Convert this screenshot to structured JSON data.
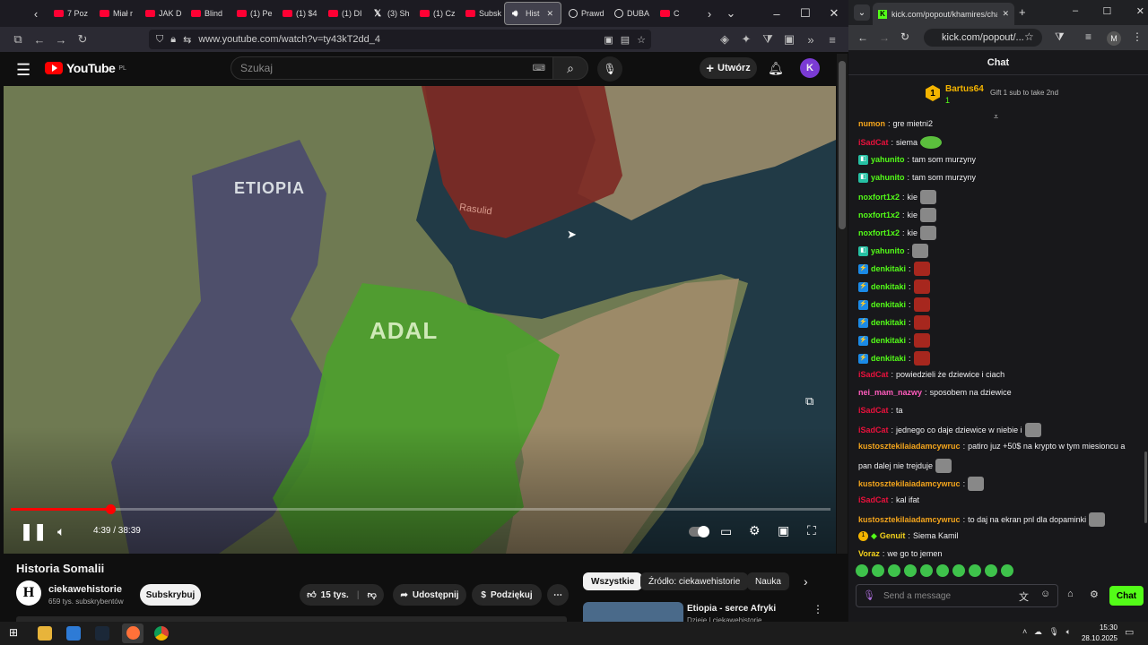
{
  "left_browser": {
    "tabs": [
      {
        "label": "7 Poz",
        "fav": "yt"
      },
      {
        "label": "Miał r",
        "fav": "yt"
      },
      {
        "label": "JAK D",
        "fav": "yt"
      },
      {
        "label": "Blind",
        "fav": "yt"
      },
      {
        "label": "(1) Pe",
        "fav": "yt"
      },
      {
        "label": "(1) $4",
        "fav": "yt"
      },
      {
        "label": "(1) DI",
        "fav": "yt"
      },
      {
        "label": "(3) Sh",
        "fav": "x"
      },
      {
        "label": "(1) Cz",
        "fav": "yt"
      },
      {
        "label": "Subsk",
        "fav": "yt"
      },
      {
        "label": "Hist",
        "fav": "audio",
        "active": true
      },
      {
        "label": "Prawd",
        "fav": "o"
      },
      {
        "label": "DUBA",
        "fav": "o"
      },
      {
        "label": "C",
        "fav": "yt"
      }
    ],
    "url": "www.youtube.com/watch?v=ty43kT2dd_4"
  },
  "youtube": {
    "logo_text": "YouTube",
    "logo_region": "PL",
    "search_placeholder": "Szukaj",
    "create_label": "Utwórz",
    "avatar_letter": "K",
    "map_labels": {
      "etiopia": "ETIOPIA",
      "adal": "ADAL",
      "rasulid": "Rasulid"
    },
    "time": "4:39 / 38:39",
    "progress_fraction": 0.121,
    "video_title": "Historia Somalii",
    "channel": {
      "avatar_letter": "H",
      "name": "ciekawehistorie",
      "subs": "659 tys. subskrybentów"
    },
    "subscribe_label": "Subskrybuj",
    "like_count": "15 tys.",
    "share_label": "Udostępnij",
    "thanks_label": "Podziękuj",
    "chips": [
      "Wszystkie",
      "Źródło: ciekawehistorie",
      "Nauka"
    ],
    "rec_title": "Etiopia - serce Afryki",
    "rec_sub": "Dzieje | ciekawehistorie"
  },
  "right_browser": {
    "tab_label": "kick.com/popout/khamires/cha",
    "url": "kick.com/popout/...",
    "chat_title": "Chat",
    "pinned": {
      "rank": "1",
      "user": "Bartus64",
      "count": "1",
      "gift_text": "Gift 1 sub to take 2nd"
    },
    "messages": [
      {
        "user": "numon",
        "color": "#f4a51c",
        "text": "gre mietni2",
        "badge": "",
        "emote": ""
      },
      {
        "user": "iSadCat",
        "color": "#e9113c",
        "text": "siema",
        "badge": "",
        "emote": "green"
      },
      {
        "user": "yahunito",
        "color": "#53fc18",
        "text": "tam som murzyny",
        "badge": "g",
        "emote": ""
      },
      {
        "user": "yahunito",
        "color": "#53fc18",
        "text": "tam som murzyny",
        "badge": "g",
        "emote": ""
      },
      {
        "user": "noxfort1x2",
        "color": "#53fc18",
        "text": "kie",
        "badge": "",
        "emote": "gray"
      },
      {
        "user": "noxfort1x2",
        "color": "#53fc18",
        "text": "kie",
        "badge": "",
        "emote": "gray"
      },
      {
        "user": "noxfort1x2",
        "color": "#53fc18",
        "text": "kie",
        "badge": "",
        "emote": "gray"
      },
      {
        "user": "yahunito",
        "color": "#53fc18",
        "text": "",
        "badge": "g",
        "emote": "gray"
      },
      {
        "user": "denkitaki",
        "color": "#53fc18",
        "text": "",
        "badge": "b",
        "emote": "red"
      },
      {
        "user": "denkitaki",
        "color": "#53fc18",
        "text": "",
        "badge": "b",
        "emote": "red"
      },
      {
        "user": "denkitaki",
        "color": "#53fc18",
        "text": "",
        "badge": "b",
        "emote": "red"
      },
      {
        "user": "denkitaki",
        "color": "#53fc18",
        "text": "",
        "badge": "b",
        "emote": "red"
      },
      {
        "user": "denkitaki",
        "color": "#53fc18",
        "text": "",
        "badge": "b",
        "emote": "red"
      },
      {
        "user": "denkitaki",
        "color": "#53fc18",
        "text": "",
        "badge": "b",
        "emote": "red"
      },
      {
        "user": "iSadCat",
        "color": "#e9113c",
        "text": "powiedzieli że dziewice i ciach",
        "badge": "",
        "emote": ""
      },
      {
        "user": "nei_mam_nazwy",
        "color": "#ff5cbd",
        "text": "sposobem na dziewice",
        "badge": "",
        "emote": ""
      },
      {
        "user": "iSadCat",
        "color": "#e9113c",
        "text": "ta",
        "badge": "",
        "emote": ""
      },
      {
        "user": "iSadCat",
        "color": "#e9113c",
        "text": "jednego co daje dziewice w niebie i",
        "badge": "",
        "emote": "gray"
      },
      {
        "user": "kustosztekilaiadamcywruc",
        "color": "#f4a51c",
        "text": "patiro juz +50$ na krypto w tym miesioncu a",
        "badge": "",
        "emote": ""
      },
      {
        "user": "",
        "color": "#efeff1",
        "text": "pan dalej nie trejduje",
        "badge": "",
        "emote": "gray"
      },
      {
        "user": "kustosztekilaiadamcywruc",
        "color": "#f4a51c",
        "text": "",
        "badge": "",
        "emote": "gray"
      },
      {
        "user": "iSadCat",
        "color": "#e9113c",
        "text": "kal ifat",
        "badge": "",
        "emote": ""
      },
      {
        "user": "kustosztekilaiadamcywruc",
        "color": "#f4a51c",
        "text": "to daj na ekran pnl dla dopaminki",
        "badge": "",
        "emote": "gray"
      },
      {
        "user": "Genuit",
        "color": "#f4d21c",
        "text": "Siema Kamil",
        "badge": "gift",
        "emote": ""
      },
      {
        "user": "Voraz",
        "color": "#f4d21c",
        "text": "we go to jemen",
        "badge": "",
        "emote": ""
      }
    ],
    "input_placeholder": "Send a message",
    "chat_button": "Chat"
  },
  "taskbar": {
    "time": "15:30",
    "date": "28.10.2025"
  }
}
